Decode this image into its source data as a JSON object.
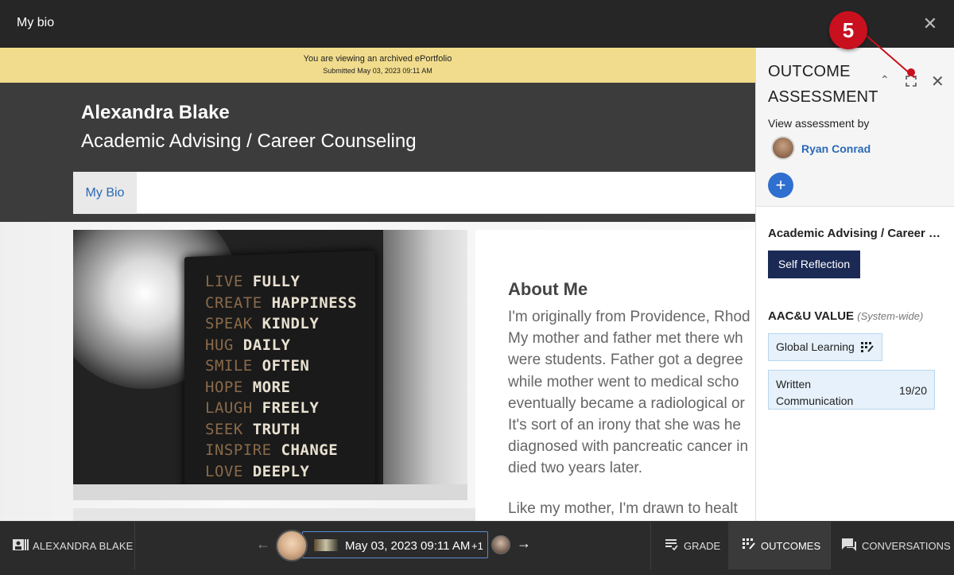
{
  "topbar": {
    "title": "My bio",
    "close_icon": "close-icon"
  },
  "banner": {
    "line1": "You are viewing an archived ePortfolio",
    "line2": "Submitted May 03, 2023 09:11 AM"
  },
  "profile": {
    "name": "Alexandra Blake",
    "subtitle": "Academic Advising / Career Counseling"
  },
  "nav": {
    "tabs": [
      {
        "label": "My Bio",
        "active": true
      }
    ]
  },
  "quote_lines": [
    [
      "LIVE",
      "FULLY"
    ],
    [
      "CREATE",
      "HAPPINESS"
    ],
    [
      "SPEAK",
      "KINDLY"
    ],
    [
      "HUG",
      "DAILY"
    ],
    [
      "SMILE",
      "OFTEN"
    ],
    [
      "HOPE",
      "MORE"
    ],
    [
      "LAUGH",
      "FREELY"
    ],
    [
      "SEEK",
      "TRUTH"
    ],
    [
      "INSPIRE",
      "CHANGE"
    ],
    [
      "LOVE",
      "DEEPLY"
    ]
  ],
  "about": {
    "heading": "About Me",
    "lines": [
      "I'm originally from Providence, Rhod",
      "My mother and father met there wh",
      "were students. Father got a degree",
      "while mother went to medical scho",
      "eventually became a radiological or",
      "It's sort of an irony that she was he",
      "diagnosed with pancreatic cancer in",
      "died two years later."
    ],
    "line_next": "Like my mother, I'm drawn to healt"
  },
  "outcome_panel": {
    "title": "OUTCOME ASSESSMENT",
    "view_by_label": "View assessment by",
    "assessor": "Ryan Conrad",
    "add_label": "+",
    "section1_title": "Academic Advising / Career Counseling",
    "section1_chip": "Self Reflection",
    "section2_title": "AAC&U VALUE",
    "section2_suffix": "(System-wide)",
    "chip_global": "Global Learning",
    "chip_written": "Written Communication",
    "chip_written_score": "19/20"
  },
  "step_marker": {
    "number": "5",
    "color": "#c8101e"
  },
  "bottombar": {
    "user_label": "ALEXANDRA BLAKE",
    "date_label": "May 03, 2023 09:11 AM",
    "extra_count": "+1",
    "grade_label": "GRADE",
    "outcomes_label": "OUTCOMES",
    "conversations_label": "CONVERSATIONS"
  },
  "colors": {
    "accent": "#2f6fcf",
    "banner": "#f0dc8c",
    "dark_chip": "#1b2a55",
    "light_chip": "#e6f1fb"
  }
}
